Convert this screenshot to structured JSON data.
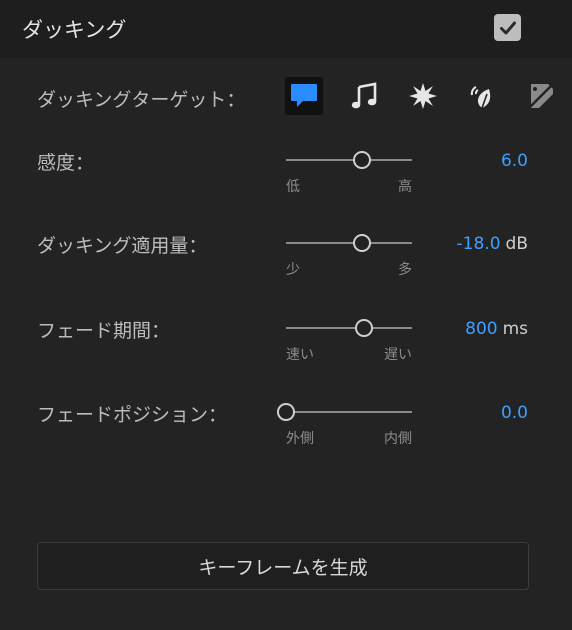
{
  "header": {
    "title": "ダッキング",
    "enabled": true
  },
  "ducking_target": {
    "label": "ダッキングターゲット：",
    "icons": [
      {
        "name": "dialogue-icon",
        "selected": true,
        "color": "#2a8cff"
      },
      {
        "name": "music-icon",
        "selected": false
      },
      {
        "name": "sfx-icon",
        "selected": false
      },
      {
        "name": "ambience-icon",
        "selected": false
      },
      {
        "name": "unassigned-icon",
        "selected": false
      }
    ]
  },
  "sliders": [
    {
      "label": "感度：",
      "min_label": "低",
      "max_label": "高",
      "position": 0.6,
      "value": "6.0",
      "unit": ""
    },
    {
      "label": "ダッキング適用量：",
      "min_label": "少",
      "max_label": "多",
      "position": 0.6,
      "value": "-18.0",
      "unit": "dB"
    },
    {
      "label": "フェード期間：",
      "min_label": "速い",
      "max_label": "遅い",
      "position": 0.62,
      "value": "800",
      "unit": "ms"
    },
    {
      "label": "フェードポジション：",
      "min_label": "外側",
      "max_label": "内側",
      "position": 0.0,
      "value": "0.0",
      "unit": ""
    }
  ],
  "keyframe_button": {
    "label": "キーフレームを生成"
  },
  "colors": {
    "accent": "#3ba0ff",
    "background": "#232323",
    "header": "#1e1e1e"
  }
}
